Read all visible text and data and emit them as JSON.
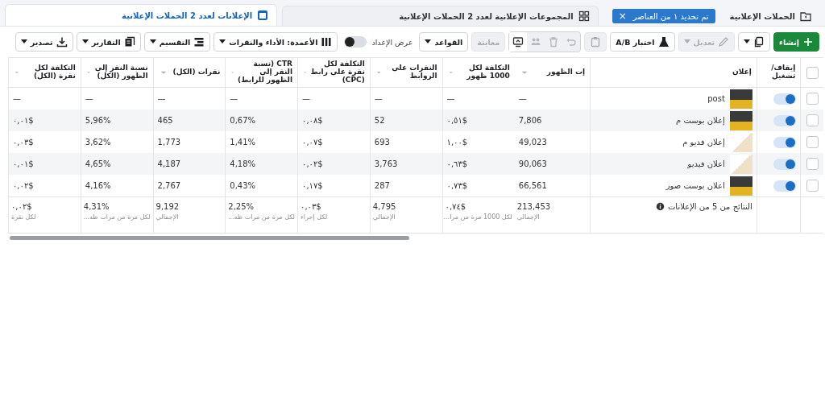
{
  "tabs": [
    {
      "label": "الحملات الإعلانية",
      "selected": false,
      "badge": {
        "text": "تم تحديد ١ من العناصر",
        "close": "×"
      }
    },
    {
      "label": "المجموعات الإعلانية لعدد 2 الحملات الإعلانية",
      "selected": false
    },
    {
      "label": "الإعلانات لعدد 2 الحملات الإعلانية",
      "selected": true
    }
  ],
  "toolbar": [
    {
      "kind": "button",
      "label": "إنشاء",
      "dropdown": false,
      "disabled": false
    },
    {
      "kind": "icon",
      "dropdown": true,
      "disabled": false
    },
    {
      "kind": "button",
      "label": "تعديل",
      "dropdown": true,
      "disabled": true
    },
    {
      "kind": "button",
      "label": "اختبار A/B",
      "dropdown": false,
      "disabled": false
    },
    {
      "kind": "icon",
      "dropdown": false,
      "disabled": true
    },
    {
      "kind": "group",
      "items": [
        {
          "disabled": true
        },
        {
          "disabled": true
        },
        {
          "disabled": true
        },
        {
          "disabled": false
        }
      ]
    },
    {
      "kind": "button",
      "label": "معاينة",
      "dropdown": false,
      "disabled": true
    },
    {
      "kind": "button",
      "label": "القواعد",
      "dropdown": true,
      "disabled": false
    },
    {
      "kind": "toggle",
      "label": "عرض الإعداد",
      "on": false
    },
    {
      "kind": "button",
      "label": "الأعمدة: الأداء والنقرات",
      "dropdown": true,
      "disabled": false
    },
    {
      "kind": "button",
      "label": "التقسيم",
      "dropdown": true,
      "disabled": false
    },
    {
      "kind": "button",
      "label": "التقارير",
      "dropdown": true,
      "disabled": false
    },
    {
      "kind": "button",
      "label": "تصدير",
      "dropdown": true,
      "disabled": false
    }
  ],
  "table": {
    "columns": [
      {
        "kind": "select",
        "checked": false
      },
      {
        "kind": "toggle",
        "label": "إيقاف/ تشغيل"
      },
      {
        "kind": "name",
        "label": "إعلان"
      },
      {
        "kind": "metric",
        "label": "إت الظهور"
      },
      {
        "kind": "metric",
        "label": "التكلفة لكل 1000 ظهور"
      },
      {
        "kind": "metric",
        "label": "النقرات على الروابط"
      },
      {
        "kind": "metric",
        "label": "التكلفة لكل نقرة على رابط (CPC)"
      },
      {
        "kind": "metric",
        "label": "CTR (نسبة النقر إلى الظهور للرابط)"
      },
      {
        "kind": "metric",
        "label": "نقرات (الكل)"
      },
      {
        "kind": "metric",
        "label": "نسبة النقر إلى الظهور (الكل)"
      },
      {
        "kind": "metric",
        "label": "التكلفة لكل نقرة (الكل)"
      }
    ],
    "rows": [
      {
        "checked": false,
        "on": true,
        "name": "post",
        "values": [
          "—",
          "—",
          "—",
          "—",
          "—",
          "—",
          "—",
          "—"
        ]
      },
      {
        "checked": false,
        "on": true,
        "name": "إعلان بوست م",
        "values": [
          "7,806",
          "٠,٥١$",
          "52",
          "٠,٠٨$",
          "0,67%",
          "465",
          "5,96%",
          "٠,٠١$"
        ]
      },
      {
        "checked": false,
        "on": true,
        "name": "إعلان فديو م",
        "values": [
          "49,023",
          "١,٠٠$",
          "693",
          "٠,٠٧$",
          "1,41%",
          "1,773",
          "3,62%",
          "٠,٠٣$"
        ]
      },
      {
        "checked": false,
        "on": true,
        "name": "اعلان فيديو",
        "values": [
          "90,063",
          "٠,٦٣$",
          "3,763",
          "٠,٠٢$",
          "4,18%",
          "4,187",
          "4,65%",
          "٠,٠١$"
        ]
      },
      {
        "checked": false,
        "on": true,
        "name": "اعلان بوست صور",
        "values": [
          "66,561",
          "٠,٧٣$",
          "287",
          "٠,١٧$",
          "0,43%",
          "2,767",
          "4,16%",
          "٠,٠٢$"
        ]
      }
    ],
    "summary": {
      "label": "النتائج من 5 من الإعلانات",
      "cells": [
        {
          "value": "213,453",
          "note": "الإجمالي"
        },
        {
          "value": "٠,٧٤$",
          "note": "لكل 1000 مرة من مرا..."
        },
        {
          "value": "4,795",
          "note": "الإجمالي"
        },
        {
          "value": "٠,٠٣$",
          "note": "لكل إجراء"
        },
        {
          "value": "2,25%",
          "note": "لكل مرة من مرات ظه..."
        },
        {
          "value": "9,192",
          "note": "الإجمالي"
        },
        {
          "value": "4,31%",
          "note": "لكل مرة من مرات ظه..."
        },
        {
          "value": "٠,٠٢$",
          "note": "لكل نقرة"
        }
      ]
    }
  }
}
